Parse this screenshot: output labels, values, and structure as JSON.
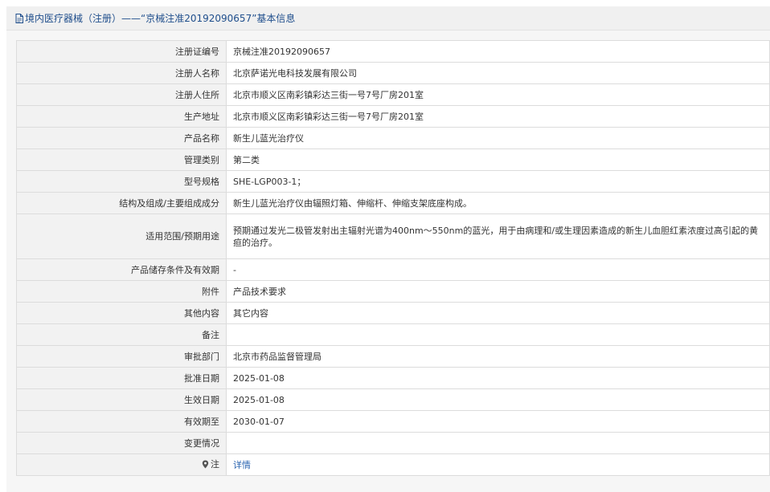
{
  "header": {
    "icon": "document-icon",
    "title": "境内医疗器械（注册）——“京械注准20192090657”基本信息"
  },
  "rows": [
    {
      "label": "注册证编号",
      "value": "京械注准20192090657"
    },
    {
      "label": "注册人名称",
      "value": "北京萨诺光电科技发展有限公司"
    },
    {
      "label": "注册人住所",
      "value": "北京市顺义区南彩镇彩达三街一号7号厂房201室"
    },
    {
      "label": "生产地址",
      "value": "北京市顺义区南彩镇彩达三街一号7号厂房201室"
    },
    {
      "label": "产品名称",
      "value": "新生儿蓝光治疗仪"
    },
    {
      "label": "管理类别",
      "value": "第二类"
    },
    {
      "label": "型号规格",
      "value": "SHE-LGP003-1；"
    },
    {
      "label": "结构及组成/主要组成成分",
      "value": "新生儿蓝光治疗仪由辐照灯箱、伸缩杆、伸缩支架底座构成。"
    },
    {
      "label": "适用范围/预期用途",
      "value": "预期通过发光二极管发射出主辐射光谱为400nm～550nm的蓝光，用于由病理和/或生理因素造成的新生儿血胆红素浓度过高引起的黄疸的治疗。"
    },
    {
      "label": "产品储存条件及有效期",
      "value": "-"
    },
    {
      "label": "附件",
      "value": "产品技术要求"
    },
    {
      "label": "其他内容",
      "value": "其它内容"
    },
    {
      "label": "备注",
      "value": ""
    },
    {
      "label": "审批部门",
      "value": "北京市药品监督管理局"
    },
    {
      "label": "批准日期",
      "value": "2025-01-08"
    },
    {
      "label": "生效日期",
      "value": "2025-01-08"
    },
    {
      "label": "有效期至",
      "value": "2030-01-07"
    },
    {
      "label": "变更情况",
      "value": ""
    }
  ],
  "note": {
    "label": "注",
    "icon": "map-pin-icon",
    "link": "详情"
  },
  "colors": {
    "header_text": "#1f4e8c",
    "link": "#2a64b0",
    "label_bg": "#f2f2f2",
    "border": "#dcdcdc"
  }
}
